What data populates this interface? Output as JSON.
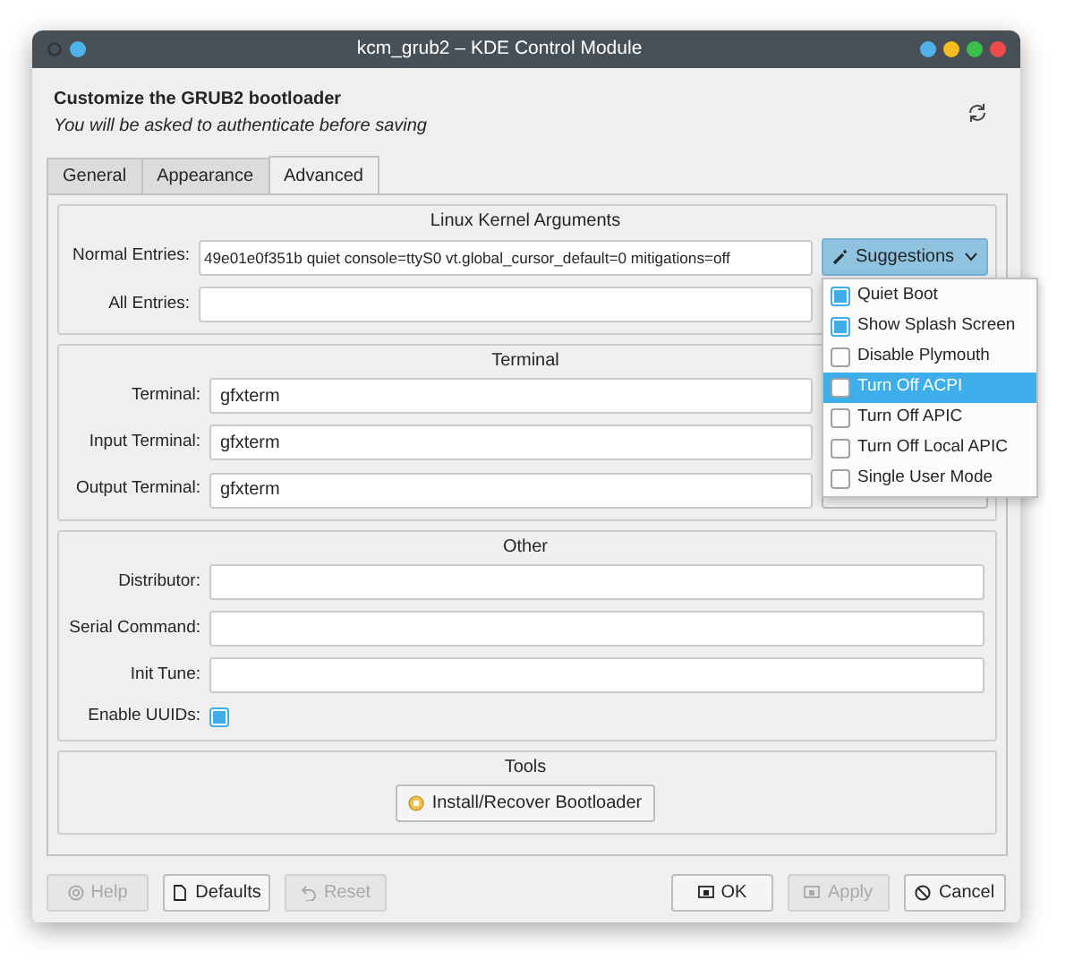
{
  "window": {
    "title": "kcm_grub2 – KDE Control Module"
  },
  "header": {
    "title": "Customize the GRUB2 bootloader",
    "subtitle": "You will be asked to authenticate before saving"
  },
  "tabs": [
    {
      "label": "General",
      "selected": false
    },
    {
      "label": "Appearance",
      "selected": false
    },
    {
      "label": "Advanced",
      "selected": true
    }
  ],
  "kernel": {
    "title": "Linux Kernel Arguments",
    "rows": [
      {
        "label": "Normal Entries:",
        "value": "49e01e0f351b quiet console=ttyS0 vt.global_cursor_default=0 mitigations=off"
      },
      {
        "label": "All Entries:",
        "value": ""
      }
    ],
    "suggestions_button": "Suggestions",
    "menu": [
      {
        "label": "Quiet Boot",
        "checked": true,
        "selected": false
      },
      {
        "label": "Show Splash Screen",
        "checked": true,
        "selected": false
      },
      {
        "label": "Disable Plymouth",
        "checked": false,
        "selected": false
      },
      {
        "label": "Turn Off ACPI",
        "checked": false,
        "selected": true
      },
      {
        "label": "Turn Off APIC",
        "checked": false,
        "selected": false
      },
      {
        "label": "Turn Off Local APIC",
        "checked": false,
        "selected": false
      },
      {
        "label": "Single User Mode",
        "checked": false,
        "selected": false
      }
    ]
  },
  "terminal": {
    "title": "Terminal",
    "rows": [
      {
        "label": "Terminal:",
        "value": "gfxterm"
      },
      {
        "label": "Input Terminal:",
        "value": "gfxterm"
      },
      {
        "label": "Output Terminal:",
        "value": "gfxterm"
      }
    ]
  },
  "other": {
    "title": "Other",
    "rows": [
      {
        "kind": "field",
        "label": "Distributor:",
        "value": ""
      },
      {
        "kind": "field",
        "label": "Serial Command:",
        "value": ""
      },
      {
        "kind": "field",
        "label": "Init Tune:",
        "value": ""
      },
      {
        "kind": "checkbox",
        "label": "Enable UUIDs:",
        "checked": true
      }
    ]
  },
  "tools": {
    "title": "Tools",
    "button": "Install/Recover Bootloader"
  },
  "footer": {
    "left": [
      {
        "label": "Help",
        "disabled": true
      },
      {
        "label": "Defaults",
        "disabled": false
      },
      {
        "label": "Reset",
        "disabled": true
      }
    ],
    "right": [
      {
        "label": "OK",
        "disabled": false
      },
      {
        "label": "Apply",
        "disabled": true
      },
      {
        "label": "Cancel",
        "disabled": false
      }
    ]
  }
}
